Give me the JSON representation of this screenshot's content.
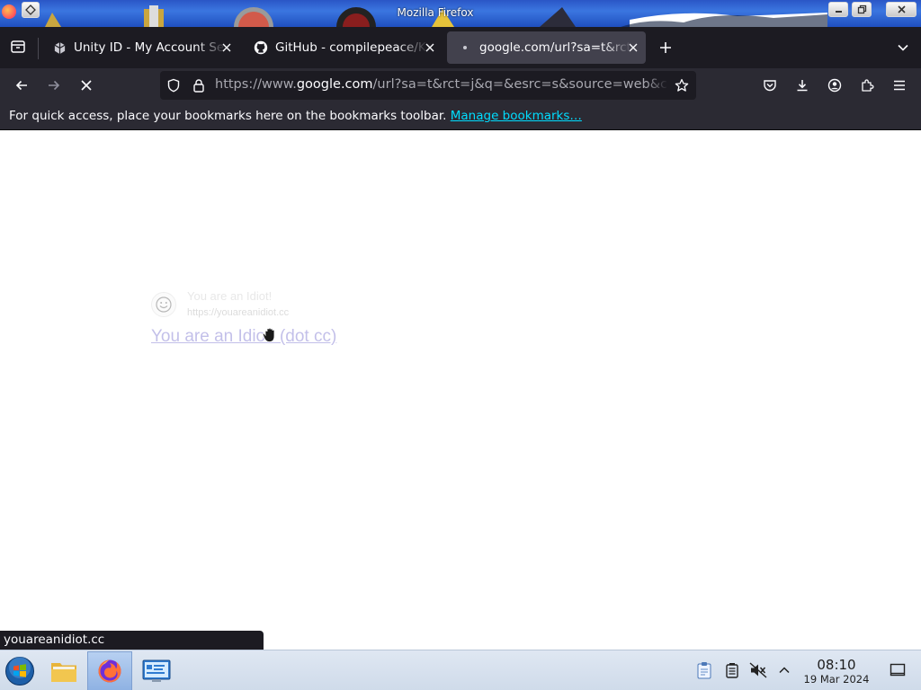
{
  "window": {
    "title": "Mozilla Firefox"
  },
  "tabs": [
    {
      "label": "Unity ID - My Account Se",
      "favicon": "unity-icon",
      "active": false
    },
    {
      "label": "GitHub - compilepeace/K",
      "favicon": "github-icon",
      "active": false
    },
    {
      "label": "google.com/url?sa=t&rct",
      "favicon": "loading-dot-icon",
      "active": true
    }
  ],
  "navbar": {
    "url_prefix": "https://www.",
    "url_host": "google.com",
    "url_rest": "/url?sa=t&rct=j&q=&esrc=s&source=web&cd="
  },
  "bookmarks_bar": {
    "message": "For quick access, place your bookmarks here on the bookmarks toolbar.",
    "link": "Manage bookmarks…"
  },
  "page": {
    "site_name": "You are an Idiot!",
    "site_url": "https://youareanidiot.cc",
    "link_text": "You are an Idiot! (dot cc)"
  },
  "status_link": "youareanidiot.cc",
  "taskbar": {
    "time": "08:10",
    "date": "19 Mar 2024"
  },
  "colors": {
    "tab_strip": "#1c1b22",
    "toolbar": "#2b2a33",
    "active_tab": "#42414d",
    "link_accent": "#00ddff"
  }
}
